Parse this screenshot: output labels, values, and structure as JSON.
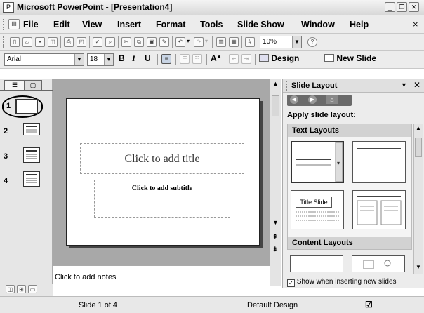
{
  "window": {
    "title": "Microsoft PowerPoint - [Presentation4]",
    "app_icon": "powerpoint-icon",
    "controls": [
      "minimize",
      "restore",
      "close"
    ]
  },
  "menubar": {
    "items": [
      "File",
      "Edit",
      "View",
      "Insert",
      "Format",
      "Tools",
      "Slide Show",
      "Window",
      "Help"
    ],
    "close_glyph": "×"
  },
  "toolbar_standard": {
    "zoom": "10%"
  },
  "toolbar_formatting": {
    "font": "Arial",
    "size": "18",
    "bold": "B",
    "italic": "I",
    "underline": "U",
    "font_size_increase": "A",
    "design_label": "Design",
    "new_slide_label": "New Slide"
  },
  "slides_pane": {
    "slides": [
      {
        "number": "1"
      },
      {
        "number": "2"
      },
      {
        "number": "3"
      },
      {
        "number": "4"
      }
    ]
  },
  "slide": {
    "title_placeholder": "Click to add title",
    "subtitle_placeholder": "Click to add subtitle"
  },
  "notes": {
    "placeholder": "Click to add notes"
  },
  "task_pane": {
    "title": "Slide Layout",
    "apply_label": "Apply slide layout:",
    "text_layouts_header": "Text Layouts",
    "title_slide_label": "Title Slide",
    "content_layouts_header": "Content Layouts",
    "show_checkbox_label": "Show when inserting new slides",
    "show_checked": true
  },
  "statusbar": {
    "slide_position": "Slide 1 of 4",
    "design": "Default Design"
  }
}
